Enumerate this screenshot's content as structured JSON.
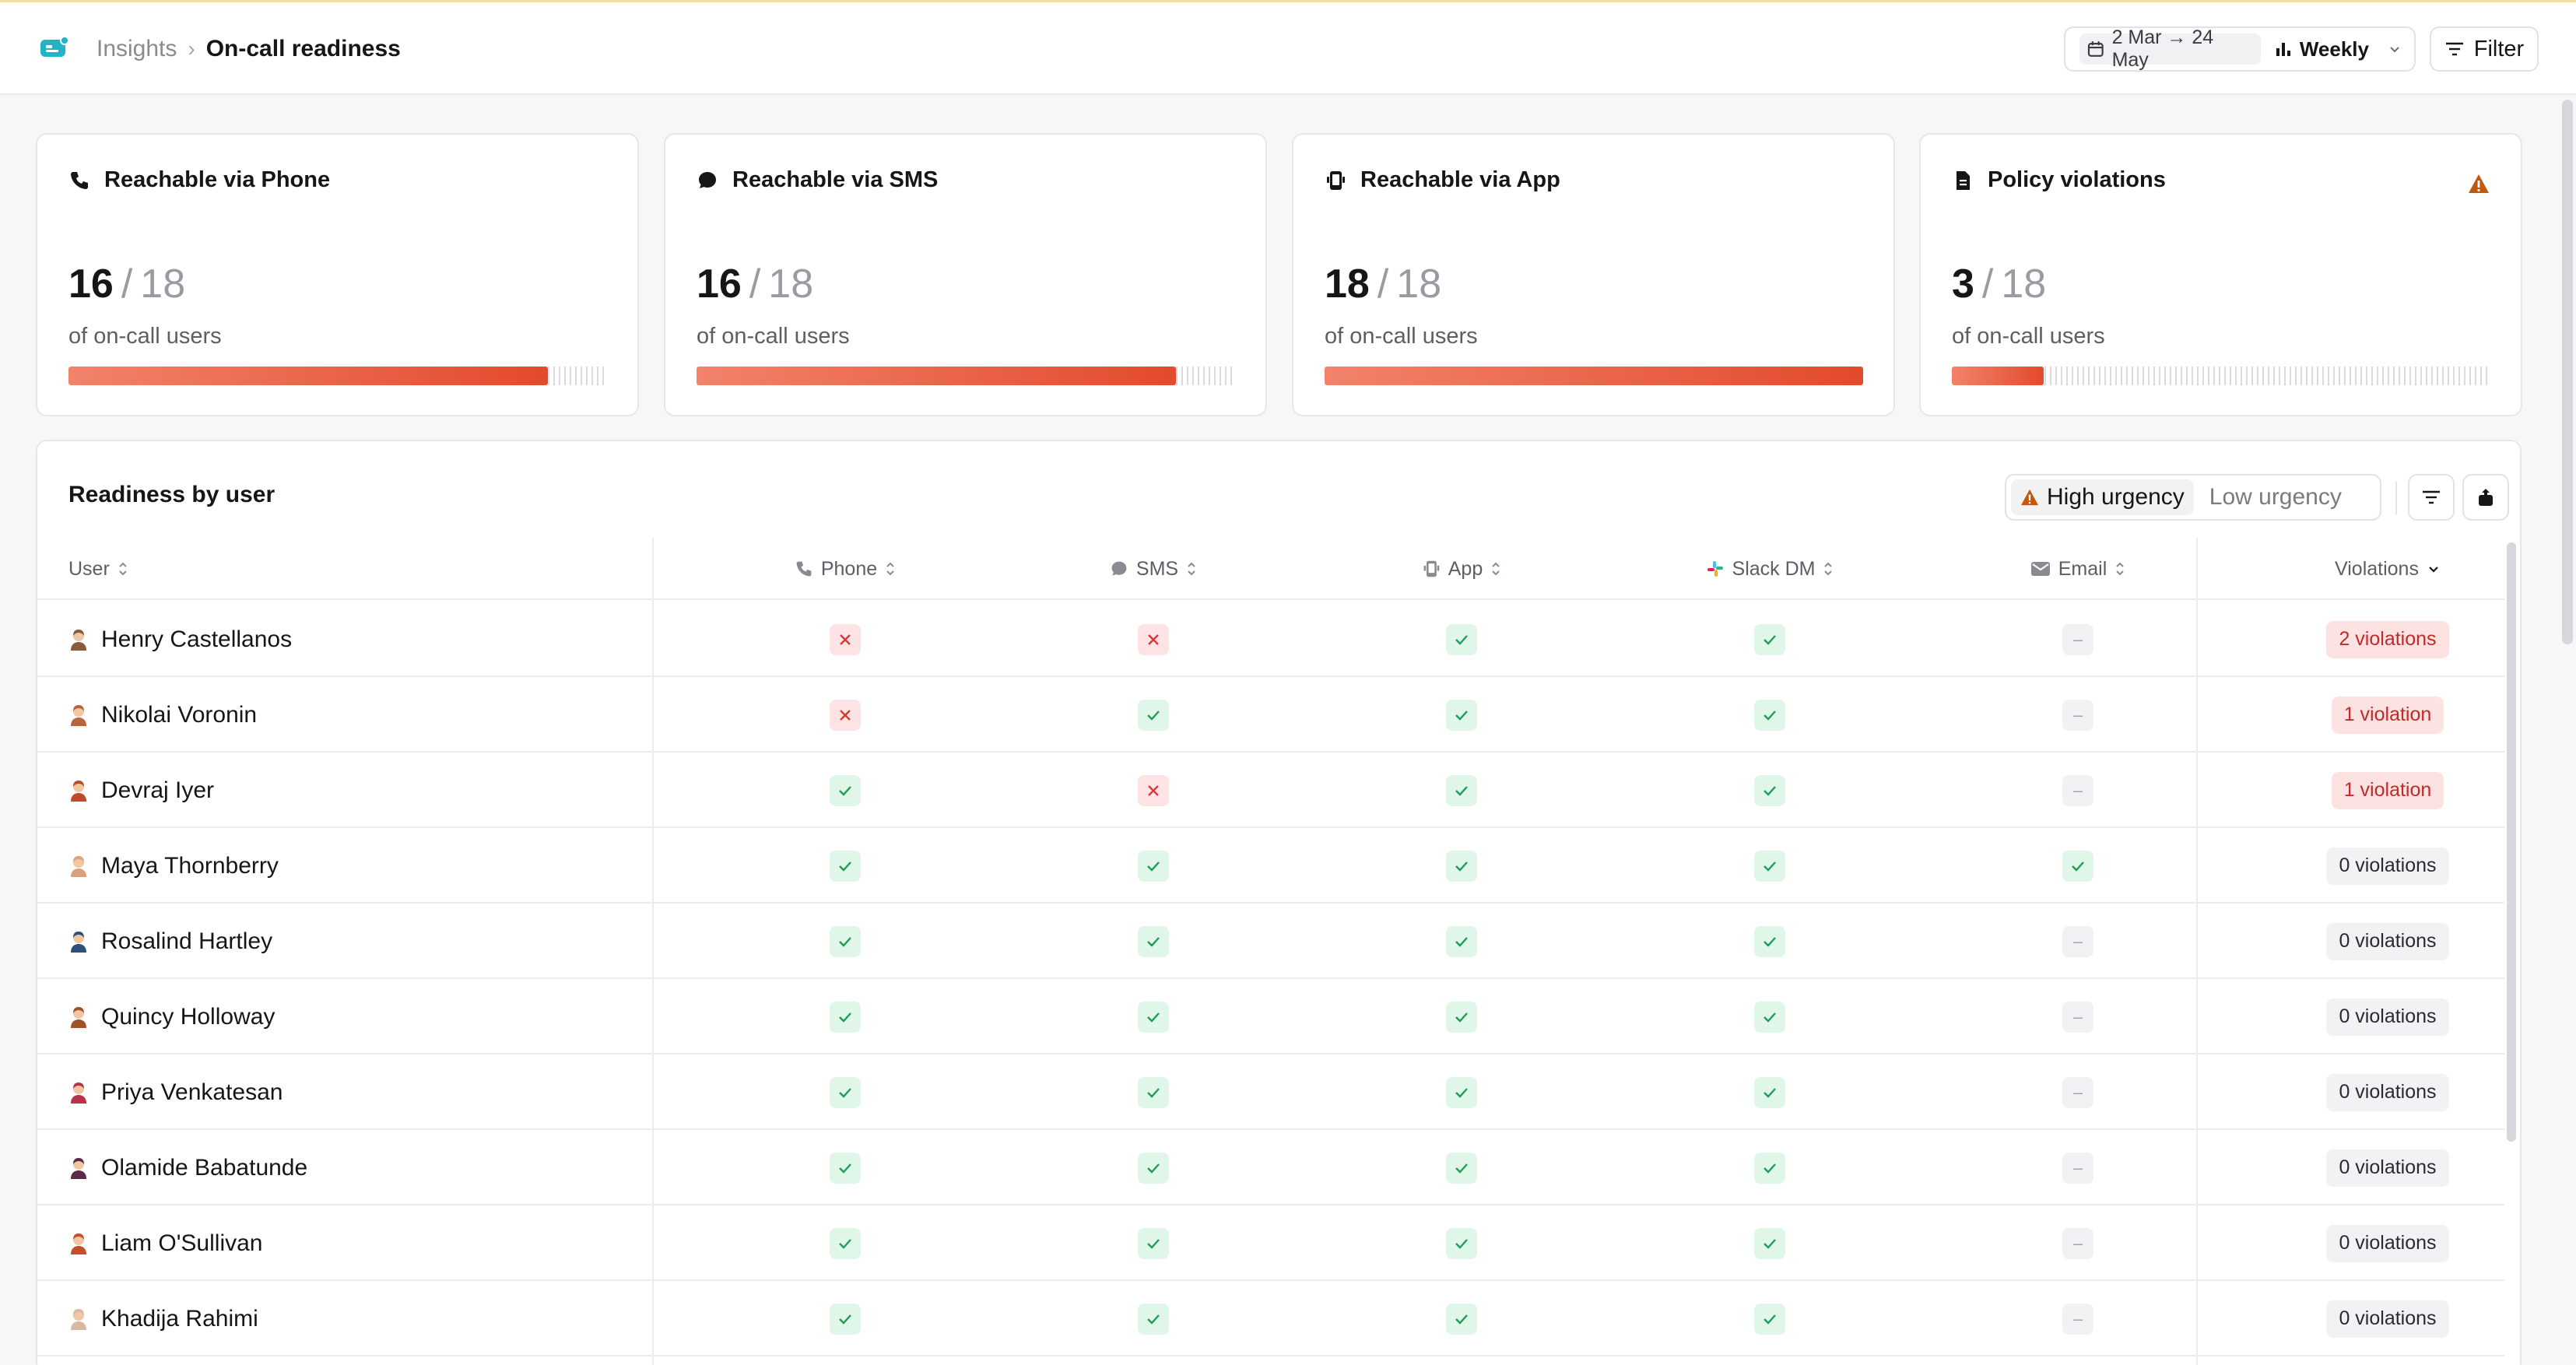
{
  "header": {
    "breadcrumb_parent": "Insights",
    "breadcrumb_separator": "›",
    "page_title": "On-call readiness",
    "date_range": "2 Mar → 24 May",
    "granularity": "Weekly",
    "filter_label": "Filter"
  },
  "cards": [
    {
      "title": "Reachable via Phone",
      "value": "16",
      "slash": "/",
      "total": "18",
      "subtitle": "of on-call users",
      "icon": "phone-icon",
      "progress": 0.89
    },
    {
      "title": "Reachable via SMS",
      "value": "16",
      "slash": "/",
      "total": "18",
      "subtitle": "of on-call users",
      "icon": "chat-bubble-icon",
      "progress": 0.89
    },
    {
      "title": "Reachable via App",
      "value": "18",
      "slash": "/",
      "total": "18",
      "subtitle": "of on-call users",
      "icon": "mobile-device-icon",
      "progress": 1.0
    },
    {
      "title": "Policy violations",
      "value": "3",
      "slash": "/",
      "total": "18",
      "subtitle": "of on-call users",
      "icon": "document-icon",
      "progress": 0.17,
      "warning": true
    }
  ],
  "table": {
    "title": "Readiness by user",
    "urgency_high": "High urgency",
    "urgency_low": "Low urgency",
    "columns": {
      "user": "User",
      "phone": "Phone",
      "sms": "SMS",
      "app": "App",
      "slack": "Slack DM",
      "email": "Email",
      "violations": "Violations"
    },
    "na_symbol": "–",
    "rows": [
      {
        "name": "Henry Castellanos",
        "phone": "no",
        "sms": "no",
        "app": "yes",
        "slack": "yes",
        "email": "na",
        "violations": "2 violations",
        "has_violations": true
      },
      {
        "name": "Nikolai Voronin",
        "phone": "no",
        "sms": "yes",
        "app": "yes",
        "slack": "yes",
        "email": "na",
        "violations": "1 violation",
        "has_violations": true
      },
      {
        "name": "Devraj Iyer",
        "phone": "yes",
        "sms": "no",
        "app": "yes",
        "slack": "yes",
        "email": "na",
        "violations": "1 violation",
        "has_violations": true
      },
      {
        "name": "Maya Thornberry",
        "phone": "yes",
        "sms": "yes",
        "app": "yes",
        "slack": "yes",
        "email": "yes",
        "violations": "0 violations",
        "has_violations": false
      },
      {
        "name": "Rosalind Hartley",
        "phone": "yes",
        "sms": "yes",
        "app": "yes",
        "slack": "yes",
        "email": "na",
        "violations": "0 violations",
        "has_violations": false
      },
      {
        "name": "Quincy Holloway",
        "phone": "yes",
        "sms": "yes",
        "app": "yes",
        "slack": "yes",
        "email": "na",
        "violations": "0 violations",
        "has_violations": false
      },
      {
        "name": "Priya Venkatesan",
        "phone": "yes",
        "sms": "yes",
        "app": "yes",
        "slack": "yes",
        "email": "na",
        "violations": "0 violations",
        "has_violations": false
      },
      {
        "name": "Olamide Babatunde",
        "phone": "yes",
        "sms": "yes",
        "app": "yes",
        "slack": "yes",
        "email": "na",
        "violations": "0 violations",
        "has_violations": false
      },
      {
        "name": "Liam O'Sullivan",
        "phone": "yes",
        "sms": "yes",
        "app": "yes",
        "slack": "yes",
        "email": "na",
        "violations": "0 violations",
        "has_violations": false
      },
      {
        "name": "Khadija Rahimi",
        "phone": "yes",
        "sms": "yes",
        "app": "yes",
        "slack": "yes",
        "email": "na",
        "violations": "0 violations",
        "has_violations": false
      }
    ]
  },
  "colors": {
    "accent_bar_start": "#f3826a",
    "accent_bar_end": "#e24b2c",
    "success_bg": "#dff6e8",
    "success_fg": "#1f9d55",
    "danger_bg": "#fde3e3",
    "danger_fg": "#d33a3a",
    "warning": "#c2580e",
    "logo": "#22b3c6"
  }
}
